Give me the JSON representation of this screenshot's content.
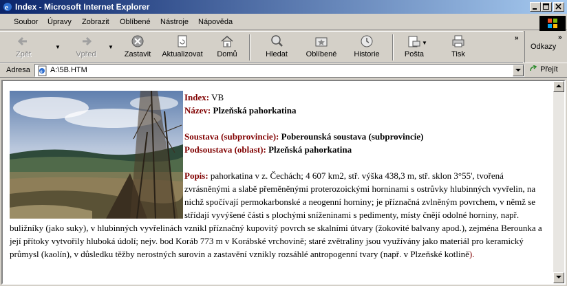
{
  "window": {
    "title": "Index - Microsoft Internet Explorer"
  },
  "menu": [
    "Soubor",
    "Úpravy",
    "Zobrazit",
    "Oblíbené",
    "Nástroje",
    "Nápověda"
  ],
  "toolbar": {
    "back": "Zpět",
    "forward": "Vpřed",
    "stop": "Zastavit",
    "refresh": "Aktualizovat",
    "home": "Domů",
    "search": "Hledat",
    "favorites": "Oblíbené",
    "history": "Historie",
    "mail": "Pošta",
    "print": "Tisk",
    "links": "Odkazy"
  },
  "address": {
    "label": "Adresa",
    "value": "A:\\5B.HTM",
    "go": "Přejít"
  },
  "content": {
    "index_label": "Index:",
    "index_value": "VB",
    "name_label": "Název:",
    "name_value": "Plzeňská pahorkatina",
    "system_label": "Soustava (subprovincie):",
    "system_value": "Poberounská soustava (subprovincie)",
    "subsystem_label": "Podsoustava (oblast):",
    "subsystem_value": "Plzeňská pahorkatina",
    "desc_label": "Popis:",
    "desc_text": "pahorkatina v z. Čechách; 4 607 km2, stř. výška 438,3 m, stř. sklon 3°55', tvořená zvrásněnými a slabě přeměněnými proterozoickými horninami s ostrůvky hlubinných vyvřelin, na nichž spočívají permokarbonské a neogenní horniny; je příznačná zvlněným povrchem, v němž se střídají vyvýšené části s plochými sníženinami s pedimenty, místy čnějí odolné horniny, např. buližníky (jako suky), v hlubinných vyvřelinách vznikl příznačný kupovitý povrch se skalními útvary (žokovité balvany apod.), zejména Berounka a její přítoky vytvořily hluboká údolí; nejv. bod Koráb 773 m v Korábské vrchovině; staré zvětraliny jsou využívány jako materiál pro keramický průmysl (kaolín), v důsledku těžby nerostných surovin a zastavění vznikly rozsáhlé antropogenní tvary (např. v Plzeňské kotlině",
    "desc_tail": ")."
  }
}
